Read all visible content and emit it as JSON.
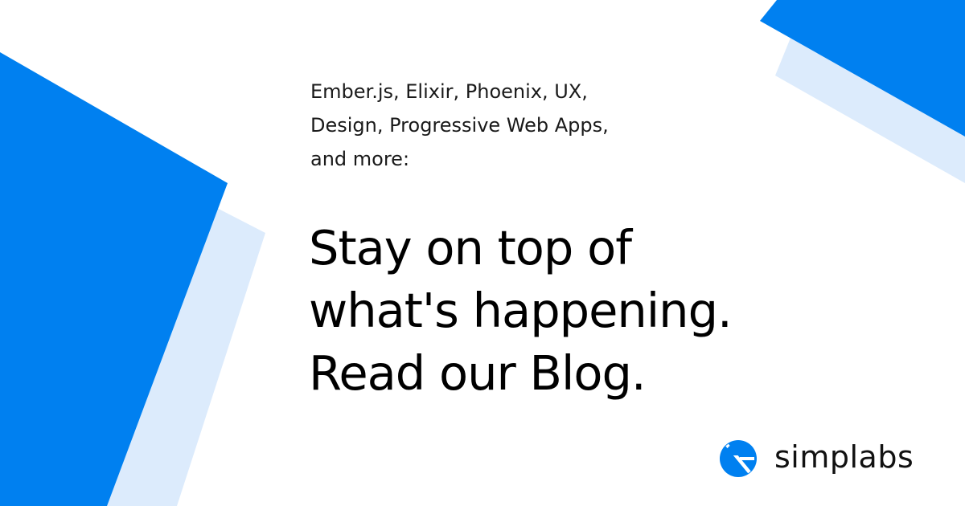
{
  "intro": {
    "lines": [
      "Ember.js, Elixir, Phoenix, UX,",
      "Design, Progressive Web Apps,",
      "and more:"
    ]
  },
  "headline": {
    "lines": [
      "Stay on top of",
      "what's happening.",
      "Read our Blog."
    ]
  },
  "brand": {
    "name": "simplabs",
    "logo_icon": "simplabs-logo-icon"
  },
  "colors": {
    "accent_blue": "#0080f0",
    "light_blue": "#dcebfc",
    "text": "#000000",
    "background": "#ffffff"
  }
}
